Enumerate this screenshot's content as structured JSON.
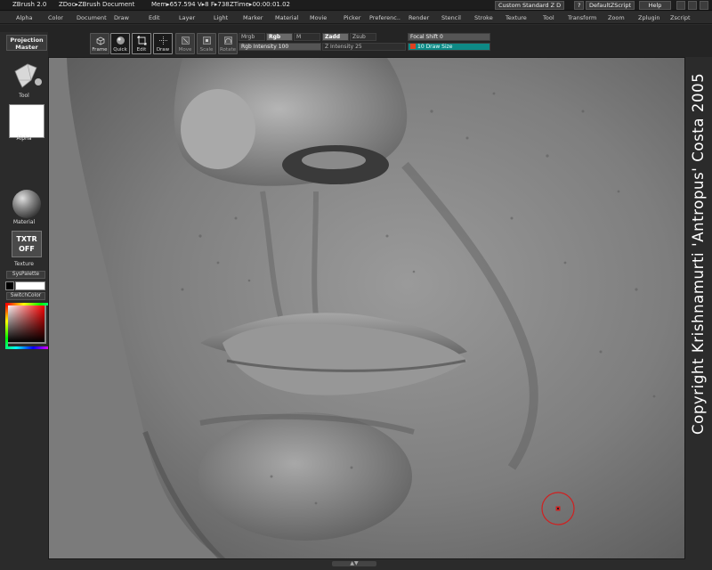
{
  "titlebar": {
    "app": "ZBrush 2.0",
    "doc": "ZDoc▸ZBrush Document",
    "mem": "Mem▸657.594  V▸8  F▸738",
    "ztime": "ZTime▸00:00:01.02",
    "custom_label": "Custom",
    "standard_label": "Standard",
    "zd_label": "Z D",
    "question": "?",
    "script_label": "DefaultZScript",
    "help_label": "Help"
  },
  "menu": [
    "Alpha",
    "Color",
    "Document",
    "Draw",
    "Edit",
    "Layer",
    "Light",
    "Marker",
    "Material",
    "Movie",
    "Picker",
    "Preferenc..",
    "Render",
    "Stencil",
    "Stroke",
    "Texture",
    "Tool",
    "Transform",
    "Zoom",
    "Zplugin",
    "Zscript"
  ],
  "toolbar": {
    "frame_label": "Frame",
    "quick_label": "Quick",
    "edit_label": "Edit",
    "draw_label": "Draw",
    "move_label": "Move",
    "scale_label": "Scale",
    "rotate_label": "Rotate",
    "mrgb_label": "Mrgb",
    "rgb_label": "Rgb",
    "m_label": "M",
    "zadd_label": "Zadd",
    "zsub_label": "Zsub",
    "rgb_intensity_label": "Rgb Intensity",
    "rgb_intensity_value": "100",
    "z_intensity_label": "Z Intensity",
    "z_intensity_value": "25",
    "focal_shift_label": "Focal Shift",
    "focal_shift_value": "0",
    "draw_size_label": "Draw Size",
    "draw_size_value": "10"
  },
  "lefttray": {
    "projection_master": "Projection Master",
    "tool_label": "Tool",
    "alpha_label": "Alpha",
    "material_label": "Material",
    "txtr_off": "TXTR OFF",
    "texture_label": "Texture",
    "syspalette": "SysPalette",
    "switchcolor": "SwitchColor"
  },
  "watermark": "Copyright Krishnamurti 'Antropus' Costa 2005",
  "icons": [
    "frame-icon",
    "sphere-icon",
    "edit-icon",
    "draw-icon",
    "move-icon",
    "scale-icon",
    "rotate-icon",
    "tool-icon",
    "brush-cursor-icon"
  ]
}
